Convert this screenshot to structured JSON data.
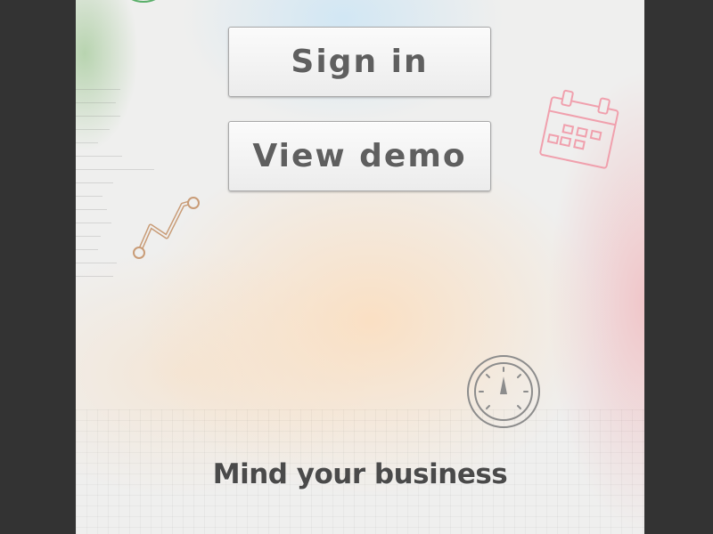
{
  "screen": {
    "buttons": {
      "sign_in_label": "Sign in",
      "view_demo_label": "View demo"
    },
    "tagline": "Mind your business"
  },
  "icons": {
    "top": "pie-chart-icon",
    "graph": "line-graph-icon",
    "calendar": "calendar-icon",
    "gauge": "speedometer-icon"
  },
  "colors": {
    "background": "#333333",
    "screen": "#efefee",
    "button_text": "#5f5f5f",
    "tagline": "#4a4a4a",
    "calendar_icon": "#f0a0ad",
    "graph_icon": "#c99c77",
    "gauge_icon": "#8c8c8c",
    "pie_icon": "#5aaf6a"
  }
}
